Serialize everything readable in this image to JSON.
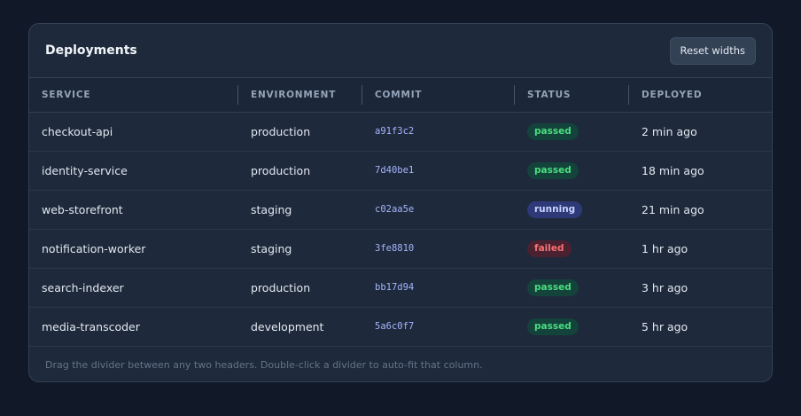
{
  "card": {
    "title": "Deployments",
    "reset_label": "Reset widths",
    "footer_hint": "Drag the divider between any two headers. Double-click a divider to auto-fit that column."
  },
  "columns": [
    "SERVICE",
    "ENVIRONMENT",
    "COMMIT",
    "STATUS",
    "DEPLOYED"
  ],
  "rows": [
    {
      "service": "checkout-api",
      "environment": "production",
      "commit": "a91f3c2",
      "status": "passed",
      "deployed": "2 min ago"
    },
    {
      "service": "identity-service",
      "environment": "production",
      "commit": "7d40be1",
      "status": "passed",
      "deployed": "18 min ago"
    },
    {
      "service": "web-storefront",
      "environment": "staging",
      "commit": "c02aa5e",
      "status": "running",
      "deployed": "21 min ago"
    },
    {
      "service": "notification-worker",
      "environment": "staging",
      "commit": "3fe8810",
      "status": "failed",
      "deployed": "1 hr ago"
    },
    {
      "service": "search-indexer",
      "environment": "production",
      "commit": "bb17d94",
      "status": "passed",
      "deployed": "3 hr ago"
    },
    {
      "service": "media-transcoder",
      "environment": "development",
      "commit": "5a6c0f7",
      "status": "passed",
      "deployed": "5 hr ago"
    }
  ],
  "colors": {
    "background": "#111827",
    "card": "#1e293b",
    "passed": "#4ade80",
    "running": "#c7d2fe",
    "failed": "#f87171"
  }
}
